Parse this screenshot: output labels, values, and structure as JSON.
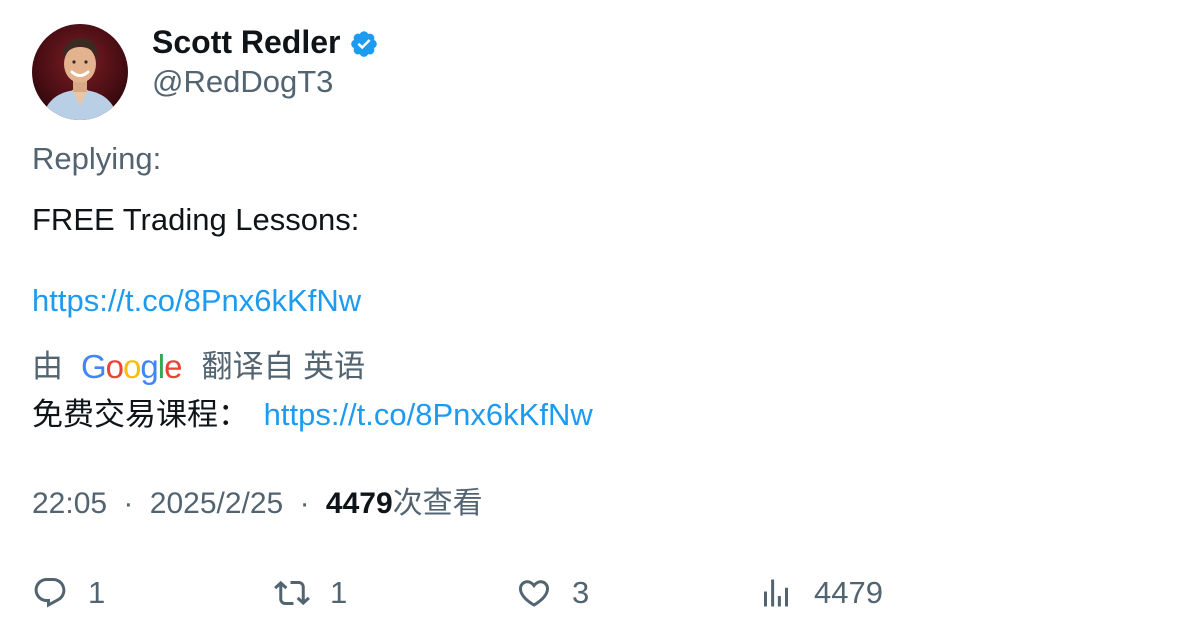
{
  "author": {
    "display_name": "Scott Redler",
    "handle": "@RedDogT3",
    "verified": true
  },
  "replying_label": "Replying:",
  "tweet": {
    "text": "FREE Trading Lessons:",
    "link": "https://t.co/8Pnx6kKfNw"
  },
  "translation": {
    "prefix": "由",
    "provider_logo": "Google",
    "suffix": "翻译自 英语",
    "text": "免费交易课程：",
    "link": "https://t.co/8Pnx6kKfNw"
  },
  "meta": {
    "time": "22:05",
    "separator": "·",
    "date": "2025/2/25",
    "views_count": "4479",
    "views_label": "次查看"
  },
  "actions": {
    "reply_count": "1",
    "retweet_count": "1",
    "like_count": "3",
    "views_count": "4479"
  },
  "colors": {
    "link": "#1d9bf0",
    "secondary_text": "#536471",
    "primary_text": "#0f1419",
    "verified_badge": "#1d9bf0"
  },
  "icons": {
    "verified": "verified-badge-icon",
    "reply": "reply-bubble-icon",
    "retweet": "retweet-arrows-icon",
    "like": "heart-icon",
    "views": "bar-chart-icon"
  }
}
